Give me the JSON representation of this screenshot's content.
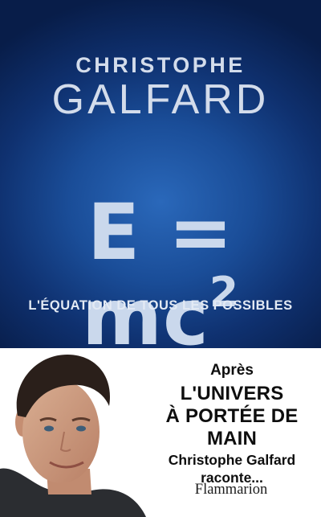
{
  "cover": {
    "author_first": "CHRISTOPHE",
    "author_last": "GALFARD",
    "equation_main": "E = mc",
    "equation_exponent": "2",
    "subtitle": "L'ÉQUATION DE TOUS LES POSSIBLES",
    "promo_line1": "Après",
    "promo_line2": "L'UNIVERS",
    "promo_line3": "À PORTÉE DE MAIN",
    "promo_line4": "Christophe Galfard raconte...",
    "publisher": "Flammarion"
  }
}
